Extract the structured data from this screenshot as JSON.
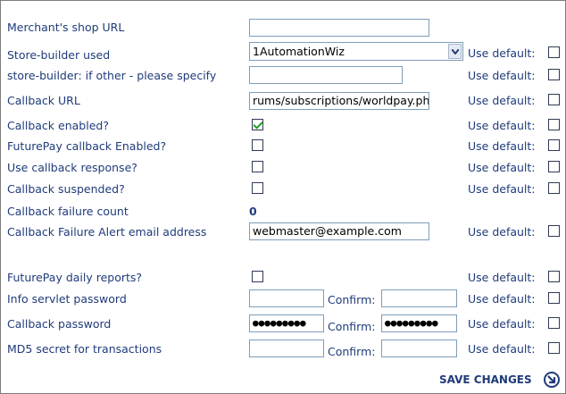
{
  "fields": {
    "shop_url": {
      "label": "Merchant's shop URL",
      "value": ""
    },
    "store_builder": {
      "label": "Store-builder used",
      "value": "1AutomationWiz"
    },
    "store_builder_other": {
      "label": "store-builder: if other - please specify",
      "value": ""
    },
    "callback_url": {
      "label": "Callback URL",
      "value": "rums/subscriptions/worldpay.php"
    },
    "callback_enabled": {
      "label": "Callback enabled?",
      "checked": true
    },
    "futurepay_callback": {
      "label": "FuturePay callback Enabled?",
      "checked": false
    },
    "use_callback_response": {
      "label": "Use callback response?",
      "checked": false
    },
    "callback_suspended": {
      "label": "Callback suspended?",
      "checked": false
    },
    "callback_failure_count": {
      "label": "Callback failure count",
      "value": "0"
    },
    "failure_email": {
      "label": "Callback Failure Alert email address",
      "value": "webmaster@example.com"
    },
    "futurepay_reports": {
      "label": "FuturePay daily reports?",
      "checked": false
    },
    "info_servlet_password": {
      "label": "Info servlet password",
      "value": "",
      "confirm": ""
    },
    "callback_password": {
      "label": "Callback password",
      "value": "●●●●●●●●●",
      "confirm": "●●●●●●●●●"
    },
    "md5_secret": {
      "label": "MD5 secret for transactions",
      "value": "",
      "confirm": ""
    }
  },
  "use_default_label": "Use default:",
  "confirm_label": "Confirm:",
  "save_label": "SAVE CHANGES",
  "icons": {
    "save": "arrow-circle-icon",
    "dropdown": "chevron-down-icon"
  },
  "colors": {
    "text": "#1f3b7a",
    "check": "#21a121"
  }
}
